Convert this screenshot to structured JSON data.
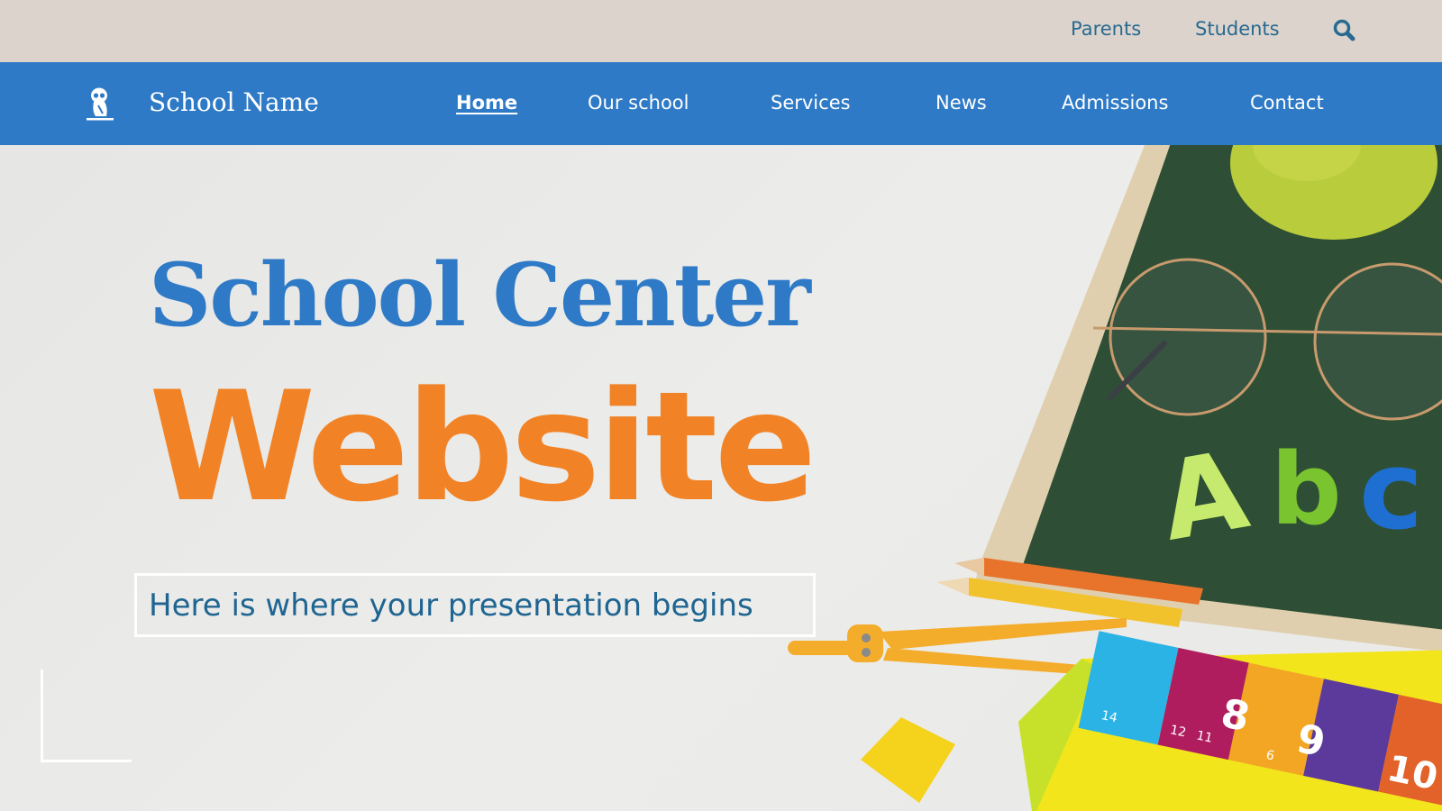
{
  "utility_nav": {
    "links": [
      {
        "label": "Parents"
      },
      {
        "label": "Students"
      }
    ],
    "search_icon": "search-icon"
  },
  "main_nav": {
    "brand": "School Name",
    "logo_icon": "owl-icon",
    "links": [
      {
        "label": "Home",
        "active": true
      },
      {
        "label": "Our school",
        "active": false
      },
      {
        "label": "Services",
        "active": false
      },
      {
        "label": "News",
        "active": false
      },
      {
        "label": "Admissions",
        "active": false
      },
      {
        "label": "Contact",
        "active": false
      }
    ]
  },
  "hero": {
    "title_line1": "School Center",
    "title_line2": "Website",
    "subtitle": "Here is where your presentation begins",
    "image_description": "School supplies on a green chalkboard: apple, glasses, Abc letters, pencils, compass, rulers",
    "ruler_labels": [
      "14",
      "12",
      "11",
      "8",
      "9",
      "6",
      "10"
    ],
    "letters": [
      "A",
      "b",
      "c"
    ]
  },
  "colors": {
    "utility_bg": "#dbd3cc",
    "nav_bg": "#2e7ac6",
    "accent_blue": "#2e7ac6",
    "accent_orange": "#f18326",
    "text_blue": "#286a92"
  }
}
